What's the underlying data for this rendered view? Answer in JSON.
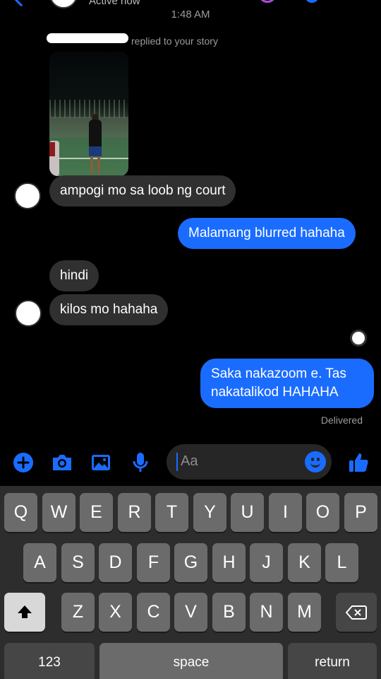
{
  "header": {
    "status": "Active now",
    "timestamp": "1:48 AM"
  },
  "story_reply": {
    "note": "replied to your story"
  },
  "messages": [
    {
      "side": "in",
      "text": "ampogi mo sa loob ng court"
    },
    {
      "side": "out",
      "text": "Malamang blurred hahaha"
    },
    {
      "side": "in",
      "text": "hindi"
    },
    {
      "side": "in",
      "text": "kilos mo hahaha"
    },
    {
      "side": "out",
      "lines": [
        "Saka nakazoom e. Tas",
        "nakatalikod HAHAHA"
      ]
    }
  ],
  "delivery_status": "Delivered",
  "composer": {
    "placeholder": "Aa"
  },
  "colors": {
    "accent": "#1a6cff",
    "incoming_bubble": "#303030",
    "background": "#000000"
  },
  "icons": [
    "plus-icon",
    "camera-icon",
    "image-icon",
    "microphone-icon",
    "emoji-icon",
    "thumbs-up-icon"
  ],
  "keyboard": {
    "row1": [
      "Q",
      "W",
      "E",
      "R",
      "T",
      "Y",
      "U",
      "I",
      "O",
      "P"
    ],
    "row2": [
      "A",
      "S",
      "D",
      "F",
      "G",
      "H",
      "J",
      "K",
      "L"
    ],
    "row3": [
      "Z",
      "X",
      "C",
      "V",
      "B",
      "N",
      "M"
    ],
    "numbers_label": "123",
    "space_label": "space",
    "return_label": "return"
  }
}
